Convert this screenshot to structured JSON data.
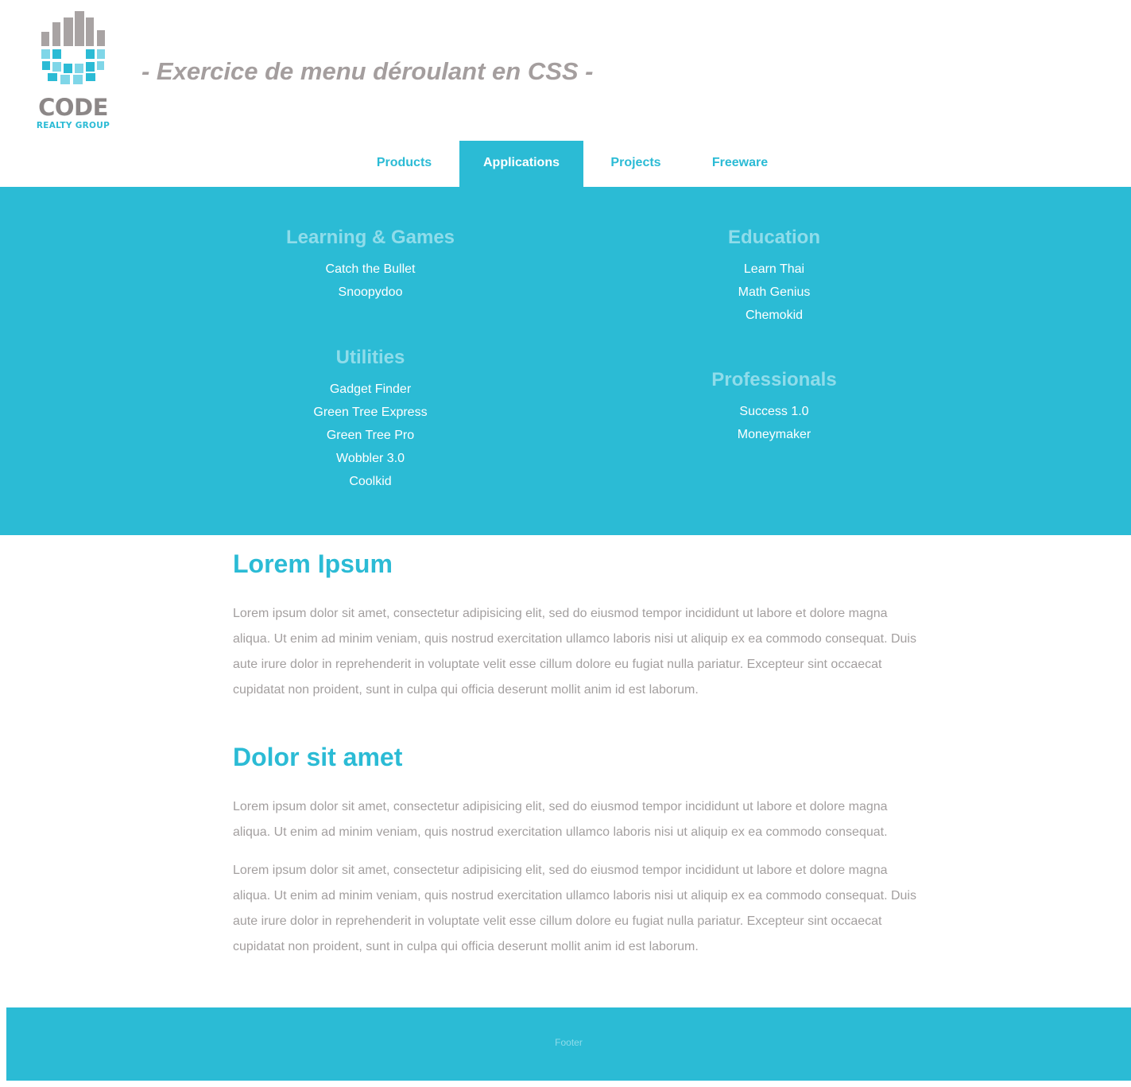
{
  "header": {
    "logo": {
      "word": "CODE",
      "sub": "REALTY GROUP"
    },
    "title": "- Exercice de menu déroulant en CSS -"
  },
  "nav": {
    "items": [
      {
        "label": "Products"
      },
      {
        "label": "Applications",
        "active": true
      },
      {
        "label": "Projects"
      },
      {
        "label": "Freeware"
      }
    ]
  },
  "dropdown": {
    "left": [
      {
        "heading": "Learning & Games",
        "items": [
          "Catch the Bullet",
          "Snoopydoo"
        ]
      },
      {
        "heading": "Utilities",
        "items": [
          "Gadget Finder",
          "Green Tree Express",
          "Green Tree Pro",
          "Wobbler 3.0",
          "Coolkid"
        ]
      }
    ],
    "right": [
      {
        "heading": "Education",
        "items": [
          "Learn Thai",
          "Math Genius",
          "Chemokid"
        ]
      },
      {
        "heading": "Professionals",
        "items": [
          "Success 1.0",
          "Moneymaker"
        ]
      }
    ]
  },
  "main": {
    "sections": [
      {
        "title": "Lorem Ipsum",
        "paragraphs": [
          "Lorem ipsum dolor sit amet, consectetur adipisicing elit, sed do eiusmod tempor incididunt ut labore et dolore magna aliqua. Ut enim ad minim veniam, quis nostrud exercitation ullamco laboris nisi ut aliquip ex ea commodo consequat. Duis aute irure dolor in reprehenderit in voluptate velit esse cillum dolore eu fugiat nulla pariatur. Excepteur sint occaecat cupidatat non proident, sunt in culpa qui officia deserunt mollit anim id est laborum."
        ]
      },
      {
        "title": "Dolor sit amet",
        "paragraphs": [
          "Lorem ipsum dolor sit amet, consectetur adipisicing elit, sed do eiusmod tempor incididunt ut labore et dolore magna aliqua. Ut enim ad minim veniam, quis nostrud exercitation ullamco laboris nisi ut aliquip ex ea commodo consequat.",
          "Lorem ipsum dolor sit amet, consectetur adipisicing elit, sed do eiusmod tempor incididunt ut labore et dolore magna aliqua. Ut enim ad minim veniam, quis nostrud exercitation ullamco laboris nisi ut aliquip ex ea commodo consequat. Duis aute irure dolor in reprehenderit in voluptate velit esse cillum dolore eu fugiat nulla pariatur. Excepteur sint occaecat cupidatat non proident, sunt in culpa qui officia deserunt mollit anim id est laborum."
        ]
      }
    ]
  },
  "footer": {
    "text": "Footer"
  },
  "colors": {
    "accent": "#2bbbd5",
    "accent_light": "#8fdcea",
    "text_gray": "#a39f9f",
    "logo_gray": "#a8a3a3"
  }
}
